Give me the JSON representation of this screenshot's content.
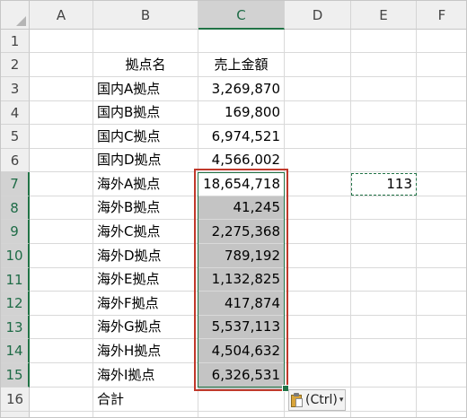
{
  "columns": [
    "A",
    "B",
    "C",
    "D",
    "E",
    "F"
  ],
  "rows": [
    "1",
    "2",
    "3",
    "4",
    "5",
    "6",
    "7",
    "8",
    "9",
    "10",
    "11",
    "12",
    "13",
    "14",
    "15",
    "16"
  ],
  "header": {
    "name_col": "拠点名",
    "sales_col": "売上金額"
  },
  "data": [
    {
      "name": "国内A拠点",
      "value": "3,269,870"
    },
    {
      "name": "国内B拠点",
      "value": "169,800"
    },
    {
      "name": "国内C拠点",
      "value": "6,974,521"
    },
    {
      "name": "国内D拠点",
      "value": "4,566,002"
    },
    {
      "name": "海外A拠点",
      "value": "18,654,718"
    },
    {
      "name": "海外B拠点",
      "value": "41,245"
    },
    {
      "name": "海外C拠点",
      "value": "2,275,368"
    },
    {
      "name": "海外D拠点",
      "value": "789,192"
    },
    {
      "name": "海外E拠点",
      "value": "1,132,825"
    },
    {
      "name": "海外F拠点",
      "value": "417,874"
    },
    {
      "name": "海外G拠点",
      "value": "5,537,113"
    },
    {
      "name": "海外H拠点",
      "value": "4,504,632"
    },
    {
      "name": "海外I拠点",
      "value": "6,326,531"
    }
  ],
  "total_label": "合計",
  "copied_cell_value": "113",
  "paste_options": {
    "label": "(Ctrl)",
    "caret": "▾"
  },
  "colors": {
    "accent": "#217346",
    "selection_outline": "#c0392b",
    "selected_fill": "#c4c4c4"
  }
}
